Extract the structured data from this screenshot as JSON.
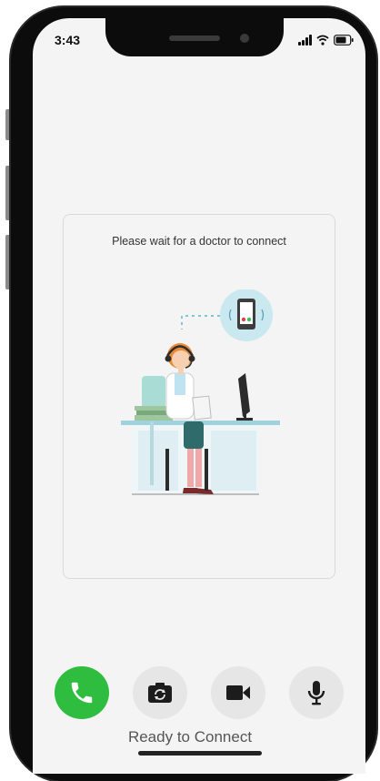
{
  "status_bar": {
    "time": "3:43"
  },
  "waiting_card": {
    "message": "Please wait for a doctor to connect",
    "illustration": "doctor-with-headset-at-desk"
  },
  "controls": [
    {
      "id": "call",
      "icon": "phone-icon",
      "color": "#2ebd3f"
    },
    {
      "id": "switch-camera",
      "icon": "camera-switch-icon"
    },
    {
      "id": "video",
      "icon": "video-camera-icon"
    },
    {
      "id": "microphone",
      "icon": "microphone-icon"
    }
  ],
  "footer": {
    "status": "Ready to Connect"
  }
}
